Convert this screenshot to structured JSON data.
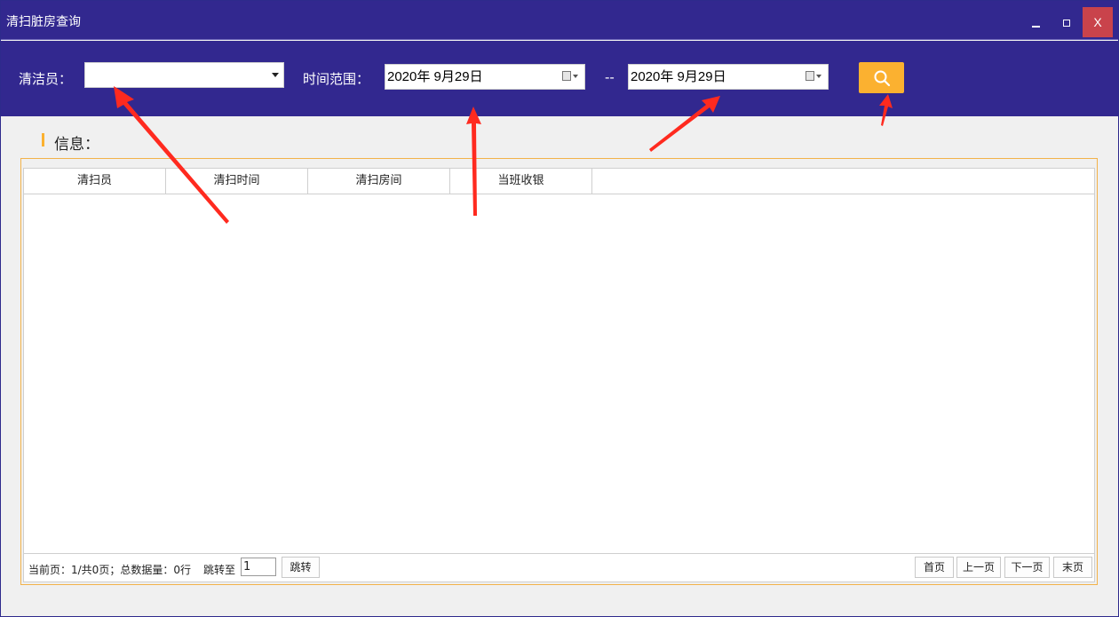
{
  "window": {
    "title": "清扫脏房查询",
    "close_label": "X"
  },
  "filters": {
    "cleaner_label": "清洁员：",
    "cleaner_value": "",
    "range_label": "时间范围：",
    "start_date": "2020年  9月29日",
    "separator": "--",
    "end_date": "2020年  9月29日"
  },
  "section": {
    "title": "信息："
  },
  "table": {
    "columns": [
      "清扫员",
      "清扫时间",
      "清扫房间",
      "当班收银"
    ],
    "rows": []
  },
  "pager": {
    "info": "当前页：1/共0页；总数据量：0行",
    "jump_label": "跳转至",
    "jump_value": "1",
    "jump_button": "跳转",
    "first": "首页",
    "prev": "上一页",
    "next": "下一页",
    "last": "末页"
  },
  "colors": {
    "header_bg": "#32288f",
    "accent": "#fbb130",
    "close_bg": "#c9434b",
    "annotation_arrow": "#ff2a1f"
  }
}
